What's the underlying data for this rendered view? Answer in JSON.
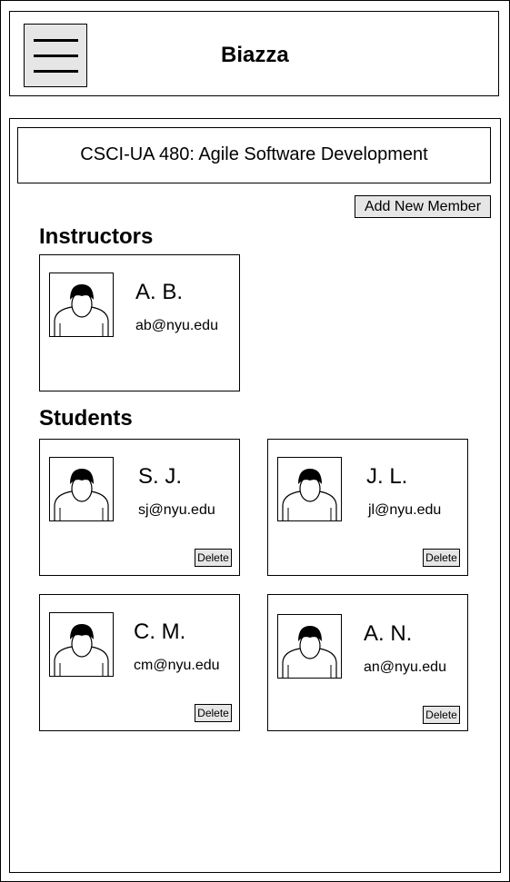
{
  "header": {
    "title": "Biazza",
    "menu_icon": "hamburger-menu-icon"
  },
  "course": {
    "title": "CSCI-UA 480: Agile Software Development"
  },
  "actions": {
    "add_member_label": "Add New Member"
  },
  "instructors": {
    "heading": "Instructors",
    "members": [
      {
        "name": "A. B.",
        "email": "ab@nyu.edu"
      }
    ]
  },
  "students": {
    "heading": "Students",
    "delete_label": "Delete",
    "members": [
      {
        "name": "S. J.",
        "email": "sj@nyu.edu"
      },
      {
        "name": "J. L.",
        "email": "jl@nyu.edu"
      },
      {
        "name": "C. M.",
        "email": "cm@nyu.edu"
      },
      {
        "name": "A. N.",
        "email": "an@nyu.edu"
      }
    ]
  },
  "colors": {
    "button_bg": "#e6e6e6",
    "border": "#000000",
    "background": "#ffffff"
  }
}
